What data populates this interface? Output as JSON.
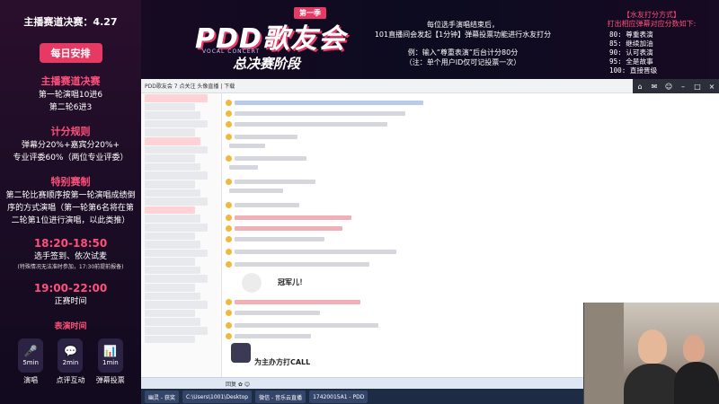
{
  "left_panel": {
    "title": "主播赛道决赛：4.27",
    "daily_badge": "每日安排",
    "track_heading": "主播赛道决赛",
    "track_lines": [
      "第一轮演唱10进6",
      "第二轮6进3"
    ],
    "scoring_heading": "计分规则",
    "scoring_lines": [
      "弹幕分20%+嘉宾分20%+",
      "专业评委60%（两位专业评委）"
    ],
    "special_heading": "特别赛制",
    "special_lines": [
      "第二轮比赛顺序按第一轮演唱成绩倒",
      "序的方式演唱（第一轮第6名将在第",
      "二轮第1位进行演唱，以此类推）"
    ],
    "slot1_time": "18:20-18:50",
    "slot1_desc": "选手签到、依次试麦",
    "slot1_note": "(特殊情况无法准时参加，17:30前提前报备)",
    "slot2_time": "19:00-22:00",
    "slot2_desc": "正赛时间",
    "perf_heading": "表演时间",
    "perf_items": [
      {
        "icon": "microphone-icon",
        "duration": "5min",
        "label": "演唱"
      },
      {
        "icon": "chat-bubble-icon",
        "duration": "2min",
        "label": "点评互动"
      },
      {
        "icon": "bar-chart-icon",
        "duration": "1min",
        "label": "弹幕投票"
      }
    ]
  },
  "banner": {
    "logo_tag": "第一季",
    "logo_main": "PDD歌友会",
    "logo_sub": "VOCAL CONCERT",
    "logo_final": "总决赛阶段",
    "rules_lines_a": [
      "每位选手演唱结束后，",
      "101直播间会发起【1分钟】弹幕投票功能进行水友打分"
    ],
    "rules_lines_b": [
      "例：输入“尊重表演”后台计分80分",
      "（注：单个用户ID仅可记投票一次）"
    ],
    "score_heading_a": "【水友打分方式】",
    "score_heading_b": "打出相应弹幕对应分数如下:",
    "score_list": [
      "80: 尊重表演",
      "85: 继续加油",
      "90: 认可表演",
      "95: 全是故事",
      "100: 直接晋级"
    ]
  },
  "screen": {
    "window_title": "PDD歌友会  7 点关注  头像直播  |  下载",
    "window_buttons": [
      "home-icon",
      "mail-icon",
      "user-icon",
      "minimize-icon",
      "maximize-icon",
      "close-icon"
    ],
    "chat_messages": [
      "冠军儿！",
      "为主办方打CALL"
    ],
    "input_hint": "回复 ✿ 😊",
    "taskbar_items": [
      "幽灵 - 获奖",
      "C:\\Users\\1001\\Desktop",
      "微信 - 音乐云直播",
      "17420015A1 - PDD"
    ]
  }
}
